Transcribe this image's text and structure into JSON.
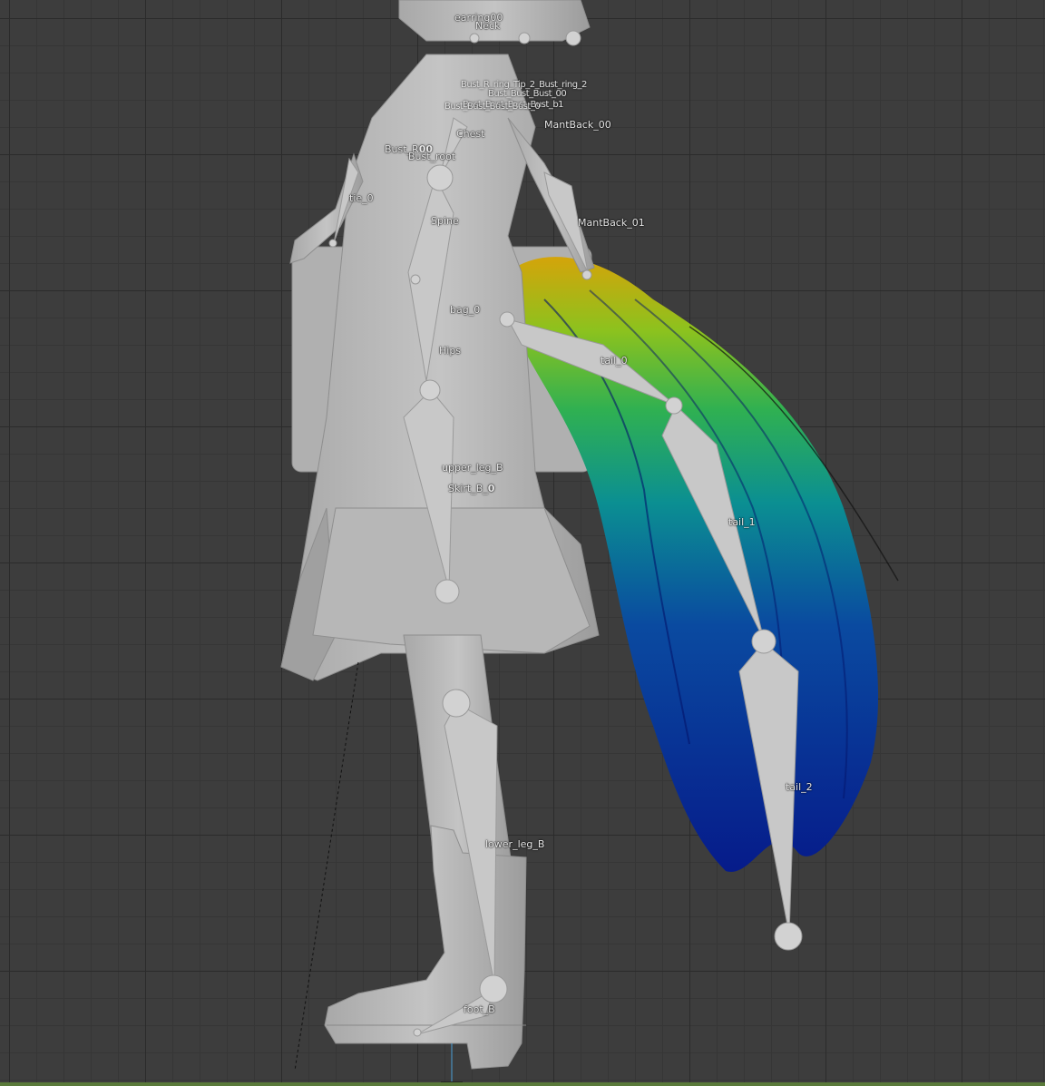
{
  "viewport": {
    "background": "#3d3d3d",
    "grid_major": "#2b2b2b",
    "grid_minor": "#363636",
    "mesh_color": "#bdbdbd",
    "bone_color": "#c8c8c8",
    "weight_gradient": [
      "#d4a40a",
      "#5fb82a",
      "#0f9a8a",
      "#0a4aa0",
      "#061b8a"
    ]
  },
  "bones": {
    "earring": "earring00",
    "neck": "Neck",
    "mantback_00": "MantBack_00",
    "chest": "Chest",
    "bust_r": "Bust_R",
    "bust_r_suffix": "00",
    "bust_root": "Bust_root",
    "tie": "tie_0",
    "spine": "Spine",
    "mantback_01": "MantBack_01",
    "bag": "bag_0",
    "hips": "Hips",
    "tail_0": "tail_0",
    "upper_leg": "upper_leg_B",
    "skirt": "Skirt_B_",
    "skirt_suffix": "0",
    "tail_1": "tail_1",
    "tail_2": "tail_2",
    "lower_leg": "lower_leg_B",
    "foot": "foot_B"
  },
  "overlap_labels": {
    "line1": "Bust_R_ring_Tip_2_Bust_ring_2",
    "line2": "Bust_Bust_Bust_00",
    "line3": "Bust_Bust_Bust_Bust_b1",
    "line4": "Bust_Bust_Bust_Bust_0"
  }
}
